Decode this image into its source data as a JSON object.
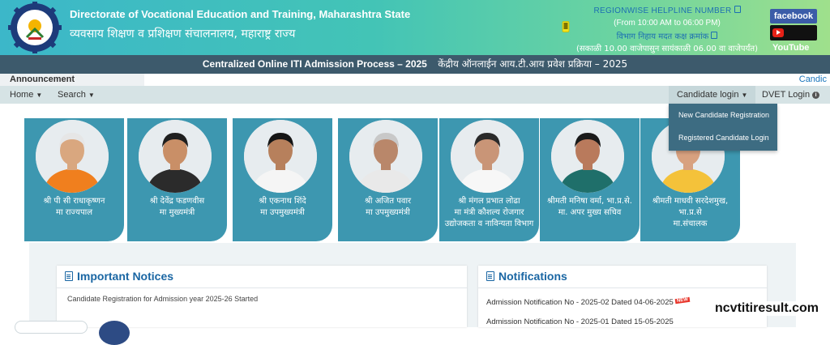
{
  "header": {
    "title_en": "Directorate of Vocational Education and Training, Maharashtra State",
    "title_mr": "व्यवसाय शिक्षण व प्रशिक्षण संचालनालय, महाराष्ट्र राज्य",
    "helpline_title": "REGIONWISE HELPLINE NUMBER",
    "helpline_time": "(From 10:00 AM to 06:00 PM)",
    "helpline_mr": "विभाग निहाय मदत कक्ष क्रमांक",
    "helpline_time_mr": "(सकाळी 10.00 वाजेपासुन सायंकाळी 06.00 वा वाजेपर्यंत)",
    "facebook_label": "facebook",
    "youtube_label": "YouTube"
  },
  "titlebar": {
    "en": "Centralized Online ITI Admission Process – 2025",
    "mr": "केंद्रीय ऑनलाईन आय.टी.आय प्रवेश प्रक्रिया – 2025"
  },
  "announcement": {
    "label": "Announcement",
    "marquee": "Candic"
  },
  "nav": {
    "home": "Home",
    "search": "Search",
    "candidate_login": "Candidate login",
    "dvet_login": "DVET Login"
  },
  "dropdown": {
    "items": [
      "New Candidate Registration",
      "Registered Candidate Login"
    ]
  },
  "leaders": [
    {
      "line1": "श्री पी सी राधाकृष्णन",
      "line2": "मा राज्यपाल",
      "line3": "",
      "skin": "#d9a77f",
      "garment": "#f07f1e",
      "hair": "#e6e6e6"
    },
    {
      "line1": "श्री देवेंद्र फडणवीस",
      "line2": "मा मुख्यमंत्री",
      "line3": "",
      "skin": "#c98f67",
      "garment": "#2b2b2b",
      "hair": "#1f1f1f"
    },
    {
      "line1": "श्री एकनाथ शिंदे",
      "line2": "मा उपमुख्यमंत्री",
      "line3": "",
      "skin": "#b7805c",
      "garment": "#f5f5f5",
      "hair": "#151515"
    },
    {
      "line1": "श्री अजित पवार",
      "line2": "मा उपमुख्यमंत्री",
      "line3": "",
      "skin": "#b9876a",
      "garment": "#e9e9e9",
      "hair": "#c8c8c8"
    },
    {
      "line1": "श्री मंगल प्रभात लोढा",
      "line2": "मा मंत्री कौशल्य रोजगार",
      "line3": "उद्योजकता व नाविन्यता विभाग",
      "skin": "#c99577",
      "garment": "#f7f7f7",
      "hair": "#2a2a2a"
    },
    {
      "line1": "श्रीमती मनिषा वर्मा, भा.प्र.से.",
      "line2": "मा. अपर मुख्य सचिव",
      "line3": "",
      "skin": "#b97a5c",
      "garment": "#1f6f6a",
      "hair": "#1a1a1a"
    },
    {
      "line1": "श्रीमती माधवी सरदेशमुख,",
      "line2": "भा.प्र.से",
      "line3": "मा.संचालक",
      "skin": "#d8a17f",
      "garment": "#f4c23a",
      "hair": "#2a1a12"
    }
  ],
  "notices": {
    "title": "Important Notices",
    "items": [
      "Candidate Registration for Admission year 2025-26 Started"
    ]
  },
  "notifications": {
    "title": "Notifications",
    "items": [
      "Admission Notification No - 2025-02 Dated 04-06-2025",
      "Admission Notification No - 2025-01 Dated 15-05-2025"
    ],
    "new_badge": "NEW"
  },
  "watermark": "ncvtitiresult.com",
  "colors": {
    "header_start": "#3cb7c9",
    "header_end": "#9fe08c",
    "titlebar": "#3d5a6c",
    "card": "#3d97b0",
    "accent": "#1a66a3"
  }
}
